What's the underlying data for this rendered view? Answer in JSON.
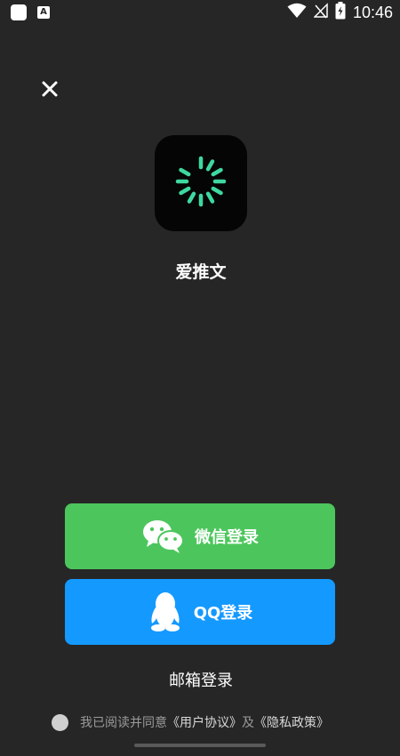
{
  "status_bar": {
    "time": "10:46",
    "app_indicator": "A",
    "icons": [
      "notification-square-icon",
      "app-a-icon",
      "wifi-icon",
      "no-signal-icon",
      "battery-charging-icon"
    ]
  },
  "close_icon": "close-icon",
  "app": {
    "name": "爱推文",
    "logo_icon": "loading-spinner-icon",
    "accent_color": "#3ed8a0"
  },
  "buttons": {
    "wechat_label": "微信登录",
    "wechat_icon": "wechat-icon",
    "wechat_color": "#4cc65c",
    "qq_label": "QQ登录",
    "qq_icon": "qq-penguin-icon",
    "qq_color": "#1499ff",
    "email_label": "邮箱登录"
  },
  "agreement": {
    "prefix": "我已阅读并同意",
    "user_agreement": "《用户协议》",
    "conjunction": "及",
    "privacy_policy": "《隐私政策》"
  }
}
